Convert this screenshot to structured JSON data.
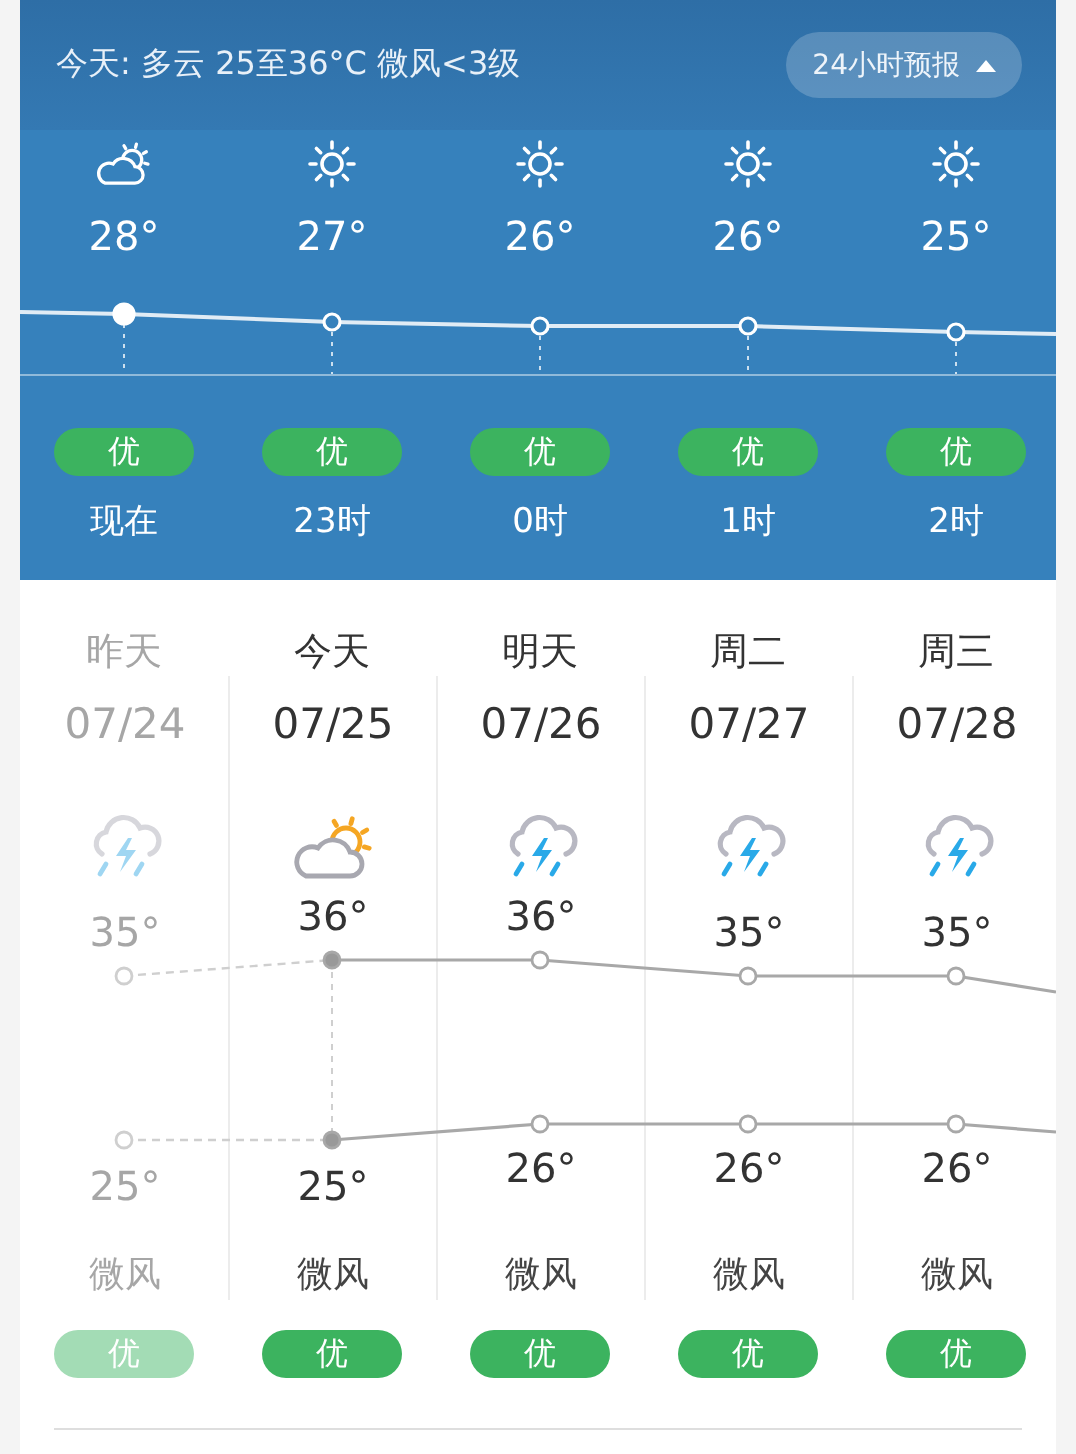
{
  "header": {
    "summary": "今天: 多云 25至36°C 微风<3级",
    "forecast_button": {
      "label": "24小时预报",
      "expanded": true
    }
  },
  "hourly": [
    {
      "kind": "partly_cloudy",
      "temp": "28°",
      "aqi": "优",
      "time": "现在",
      "current": true
    },
    {
      "kind": "sunny",
      "temp": "27°",
      "aqi": "优",
      "time": "23时",
      "current": false
    },
    {
      "kind": "sunny",
      "temp": "26°",
      "aqi": "优",
      "time": "0时",
      "current": false
    },
    {
      "kind": "sunny",
      "temp": "26°",
      "aqi": "优",
      "time": "1时",
      "current": false
    },
    {
      "kind": "sunny",
      "temp": "25°",
      "aqi": "优",
      "time": "2时",
      "current": false
    }
  ],
  "daily": [
    {
      "day": "昨天",
      "date": "07/24",
      "kind": "thunder",
      "high": "35°",
      "low": "25°",
      "wind": "微风",
      "aqi": "优",
      "past": true,
      "current": false
    },
    {
      "day": "今天",
      "date": "07/25",
      "kind": "partly_cloudy",
      "high": "36°",
      "low": "25°",
      "wind": "微风",
      "aqi": "优",
      "past": false,
      "current": true
    },
    {
      "day": "明天",
      "date": "07/26",
      "kind": "thunder",
      "high": "36°",
      "low": "26°",
      "wind": "微风",
      "aqi": "优",
      "past": false,
      "current": false
    },
    {
      "day": "周二",
      "date": "07/27",
      "kind": "thunder",
      "high": "35°",
      "low": "26°",
      "wind": "微风",
      "aqi": "优",
      "past": false,
      "current": false
    },
    {
      "day": "周三",
      "date": "07/28",
      "kind": "thunder",
      "high": "35°",
      "low": "26°",
      "wind": "微风",
      "aqi": "优",
      "past": false,
      "current": false
    }
  ]
}
